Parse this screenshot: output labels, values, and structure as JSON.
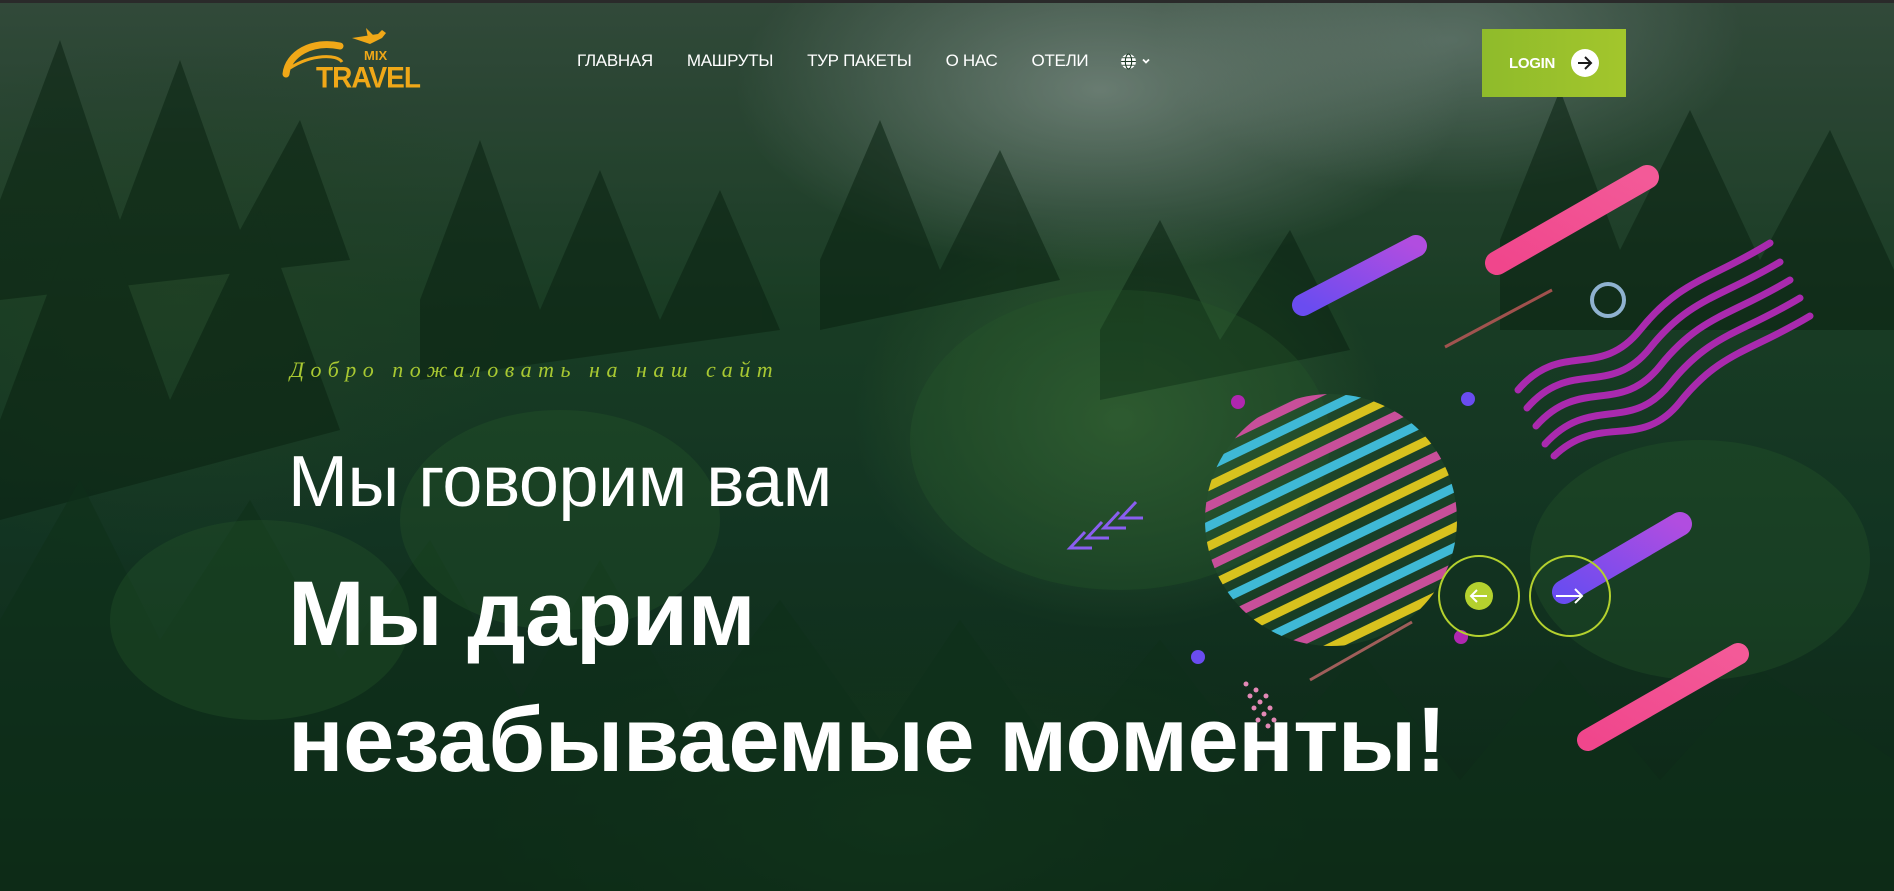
{
  "header": {
    "logo": {
      "text_main": "TRAVEL",
      "text_small": "MIX",
      "brand_color": "#f0a818"
    },
    "nav": [
      {
        "label": "ГЛАВНАЯ"
      },
      {
        "label": "МАШРУТЫ"
      },
      {
        "label": "ТУР ПАКЕТЫ"
      },
      {
        "label": "О НАС"
      },
      {
        "label": "ОТЕЛИ"
      }
    ],
    "language_icon": "globe-icon",
    "login": {
      "label": "LOGIN",
      "icon": "arrow-right-icon",
      "color": "#9bc22c"
    }
  },
  "hero": {
    "welcome": "Добро пожаловать на наш сайт",
    "line1": "Мы говорим вам",
    "line2": "Мы дарим",
    "line3": "незабываемые моменты!"
  },
  "slider": {
    "prev_icon": "arrow-left-icon",
    "next_icon": "arrow-right-icon",
    "accent": "#b4d12e"
  },
  "colors": {
    "pink": "#f0468c",
    "purple": "#8e3fe0",
    "magenta": "#b027b0",
    "cyan": "#3fb9d6",
    "yellow": "#d8c21e"
  }
}
